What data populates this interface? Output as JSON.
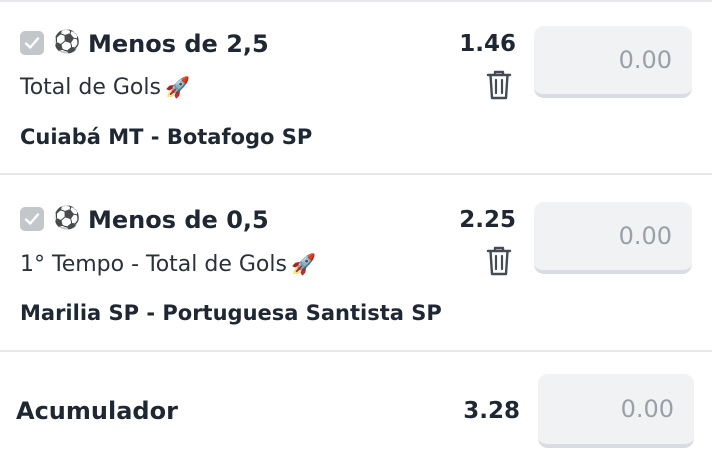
{
  "bets": [
    {
      "market": "Menos de 2,5",
      "bet_type": "Total de Gols",
      "home_team": "Cuiabá MT",
      "separator": "-",
      "away_team": "Botafogo SP",
      "odds": "1.46",
      "stake_placeholder": "0.00",
      "selected": true
    },
    {
      "market": "Menos de 0,5",
      "bet_type": "1° Tempo - Total de Gols",
      "home_team": "Marilia SP",
      "separator": "-",
      "away_team": "Portuguesa Santista SP",
      "odds": "2.25",
      "stake_placeholder": "0.00",
      "selected": true
    }
  ],
  "accumulator": {
    "label": "Acumulador",
    "odds": "3.28",
    "stake_placeholder": "0.00"
  },
  "icons": {
    "sport": "soccer-ball-icon",
    "boost": "rocket-icon",
    "remove": "trash-icon",
    "select": "checkbox-icon"
  },
  "colors": {
    "text": "#1f2733",
    "divider": "#e6e8eb",
    "input_bg": "#f1f2f4",
    "placeholder": "#9aa0a7",
    "checkbox": "#c3c7cc"
  }
}
